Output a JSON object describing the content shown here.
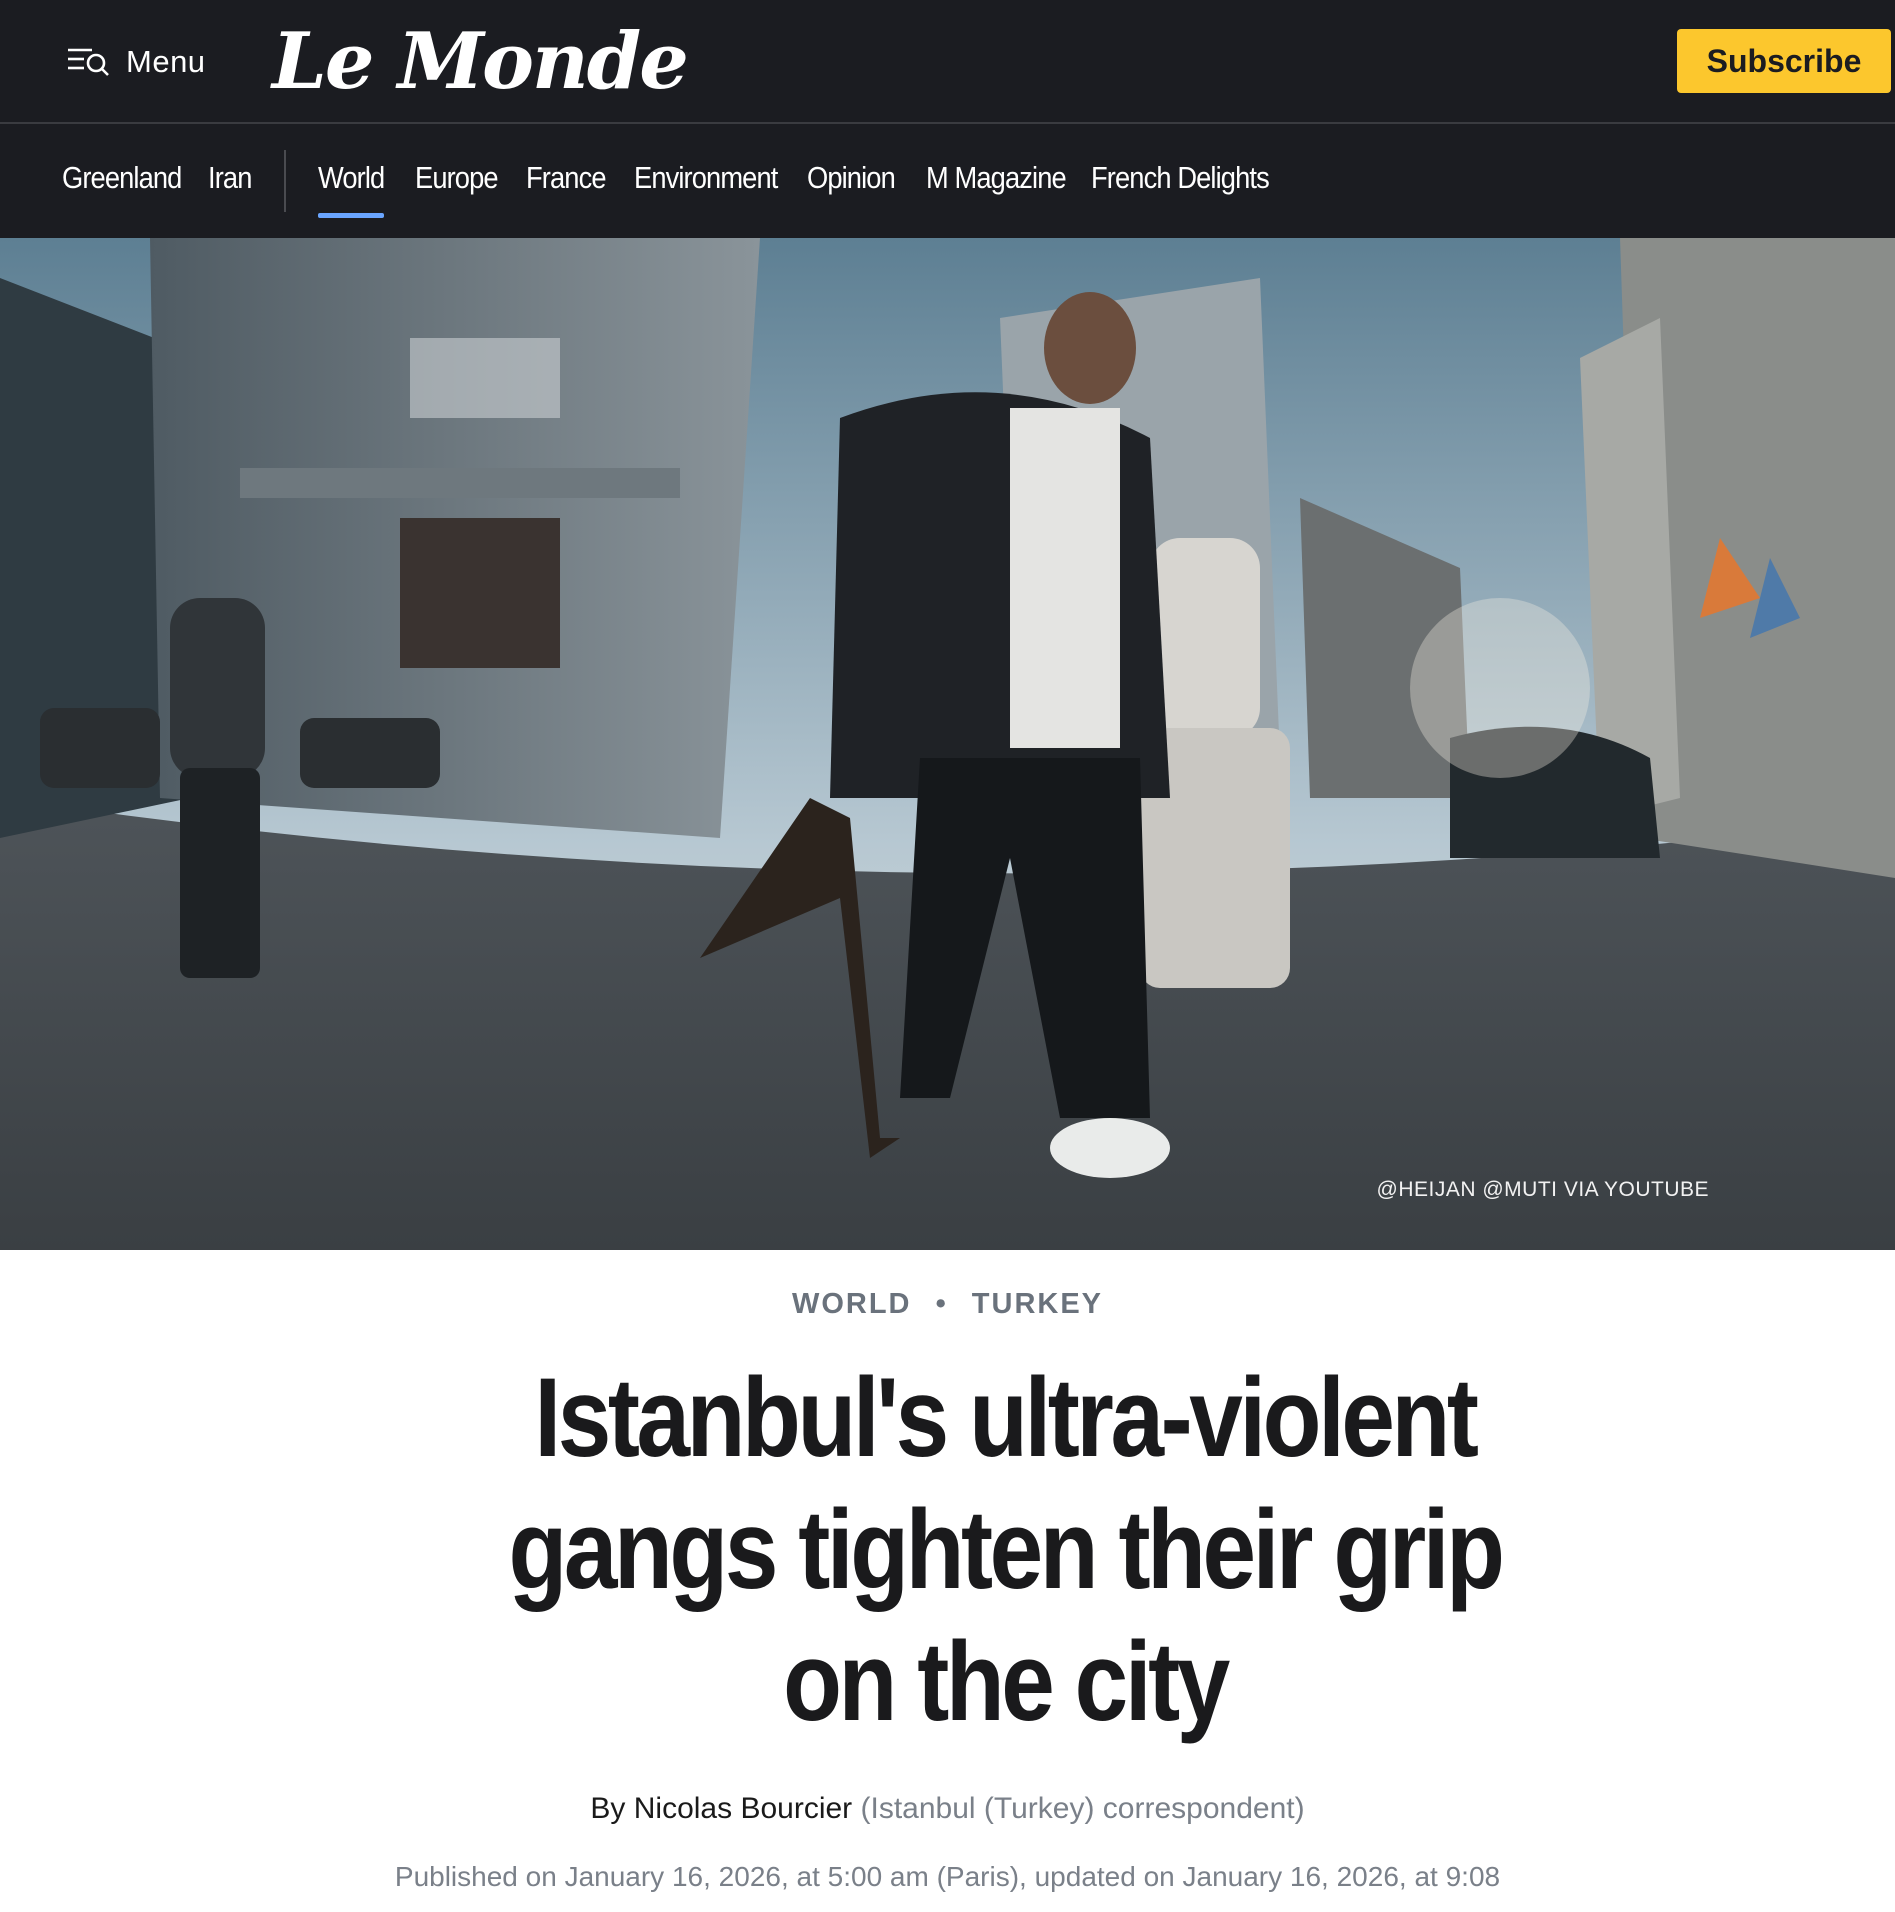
{
  "header": {
    "menu_label": "Menu",
    "menu_icon": "menu-search-icon",
    "logo_text": "Le Monde",
    "subscribe_label": "Subscribe",
    "subscribe_color": "#fcc72d",
    "background": "#1b1c21"
  },
  "nav": {
    "items": [
      {
        "label": "Greenland"
      },
      {
        "label": "Iran"
      },
      {
        "label": "World",
        "active": true
      },
      {
        "label": "Europe"
      },
      {
        "label": "France"
      },
      {
        "label": "Environment"
      },
      {
        "label": "Opinion"
      },
      {
        "label": "M Magazine"
      },
      {
        "label": "French Delights"
      }
    ],
    "active_underline_color": "#6aa5ff"
  },
  "hero": {
    "credit": "@HEIJAN @MUTI VIA YOUTUBE"
  },
  "article": {
    "kicker_section": "WORLD",
    "kicker_separator": "•",
    "kicker_topic": "TURKEY",
    "headline": "Istanbul's ultra-violent gangs tighten their grip on the city",
    "byline_author": "By Nicolas Bourcier",
    "byline_role": "(Istanbul (Turkey) correspondent)",
    "published": "Published on January 16, 2026, at 5:00 am (Paris), updated on January 16, 2026, at 9:08"
  }
}
